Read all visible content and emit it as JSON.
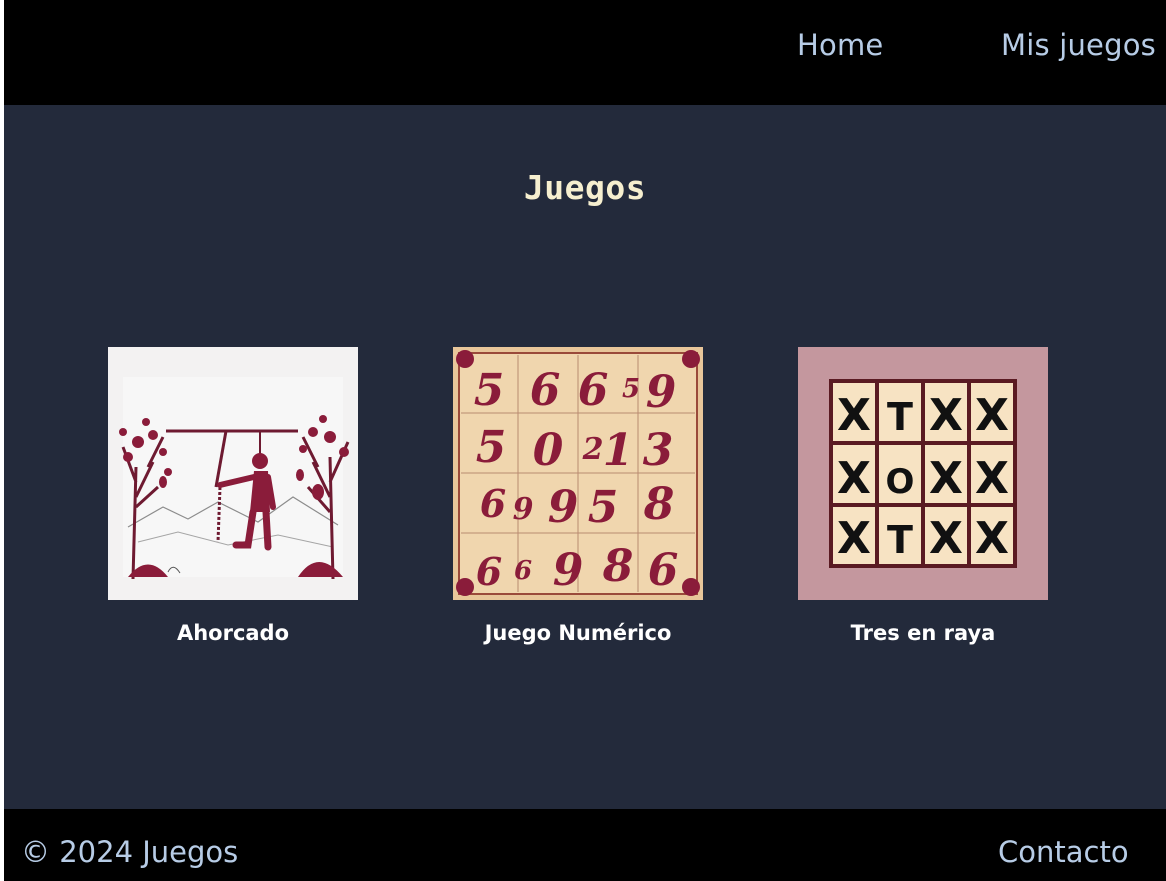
{
  "nav": {
    "home_label": "Home",
    "my_games_label": "Mis juegos"
  },
  "main": {
    "title": "Juegos",
    "games": [
      {
        "label": "Ahorcado",
        "image": "hangman-illustration"
      },
      {
        "label": "Juego Numérico",
        "image": "number-grid-illustration",
        "thumb_numbers": [
          "5",
          "6",
          "6",
          "5",
          "9",
          "5",
          "0",
          "2",
          "1",
          "3",
          "6",
          "9",
          "9",
          "5",
          "8",
          "6",
          "6",
          "9",
          "8",
          "6"
        ]
      },
      {
        "label": "Tres en raya",
        "image": "tic-tac-toe-illustration",
        "thumb_marks": [
          "X",
          "T",
          "X",
          "X",
          "X",
          "O",
          "X",
          "X",
          "X",
          "T",
          "X",
          "X"
        ]
      }
    ]
  },
  "footer": {
    "copyright": "© 2024 Juegos",
    "contact_label": "Contacto"
  },
  "colors": {
    "header_bg": "#000000",
    "page_bg": "#232a3b",
    "nav_text": "#b7cce6",
    "title_text": "#f6efcf",
    "accent_maroon": "#8a1c3a"
  }
}
